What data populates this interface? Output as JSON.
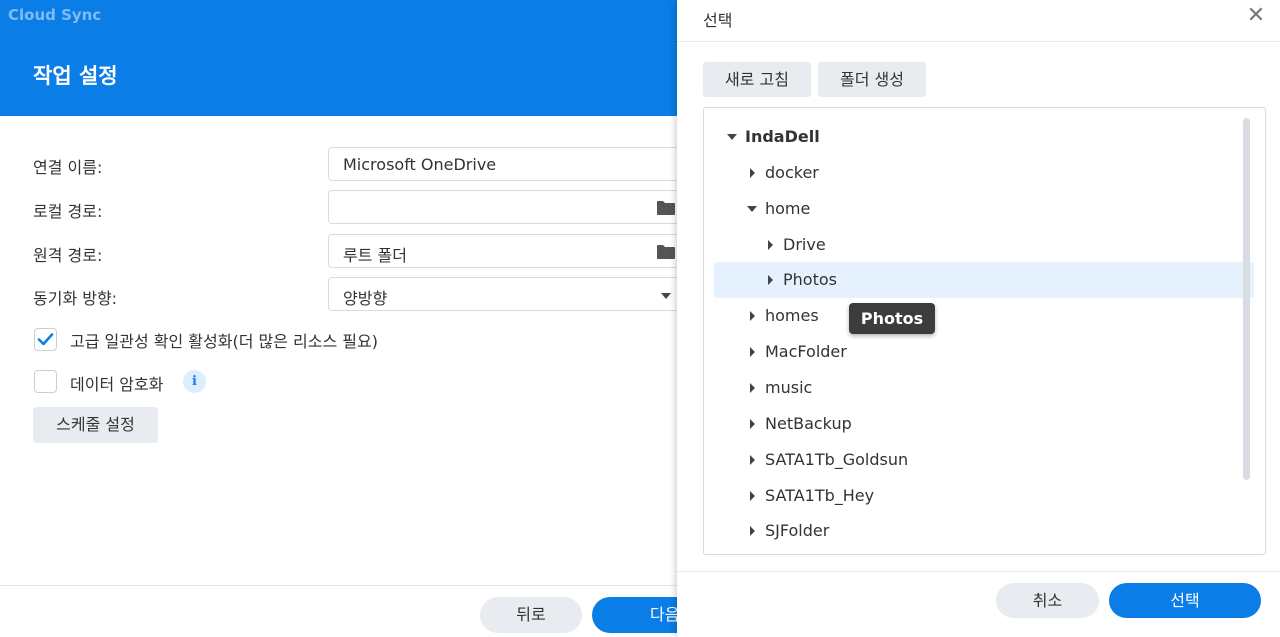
{
  "app": {
    "title": "Cloud Sync"
  },
  "wizard": {
    "title": "작업 설정",
    "fields": {
      "connection_name_label": "연결 이름:",
      "connection_name_value": "Microsoft OneDrive",
      "local_path_label": "로컬 경로:",
      "local_path_value": "",
      "remote_path_label": "원격 경로:",
      "remote_path_value": "루트 폴더",
      "sync_direction_label": "동기화 방향:",
      "sync_direction_value": "양방향"
    },
    "options": {
      "consistency_label": "고급 일관성 확인 활성화(더 많은 리소스 필요)",
      "consistency_checked": true,
      "encryption_label": "데이터 암호화",
      "encryption_checked": false,
      "info_glyph": "i"
    },
    "schedule_button": "스케줄 설정",
    "footer": {
      "back": "뒤로",
      "next": "다음"
    }
  },
  "dialog": {
    "title": "선택",
    "close_glyph": "✕",
    "toolbar": {
      "refresh": "새로 고침",
      "new_folder": "폴더 생성"
    },
    "tree": {
      "root": "IndaDell",
      "items": [
        "docker",
        "home",
        "Drive",
        "Photos",
        "homes",
        "MacFolder",
        "music",
        "NetBackup",
        "SATA1Tb_Goldsun",
        "SATA1Tb_Hey",
        "SJFolder"
      ],
      "selected": "Photos"
    },
    "tooltip": "Photos",
    "footer": {
      "cancel": "취소",
      "select": "선택"
    }
  },
  "colors": {
    "accent": "#0a7ee6",
    "selected_row": "#e5f1fc",
    "tooltip_bg": "#3c3c3c"
  },
  "icons": [
    "folder-icon",
    "chevron-down-icon",
    "check-icon",
    "info-icon",
    "close-icon",
    "caret-right-icon",
    "caret-down-icon"
  ]
}
